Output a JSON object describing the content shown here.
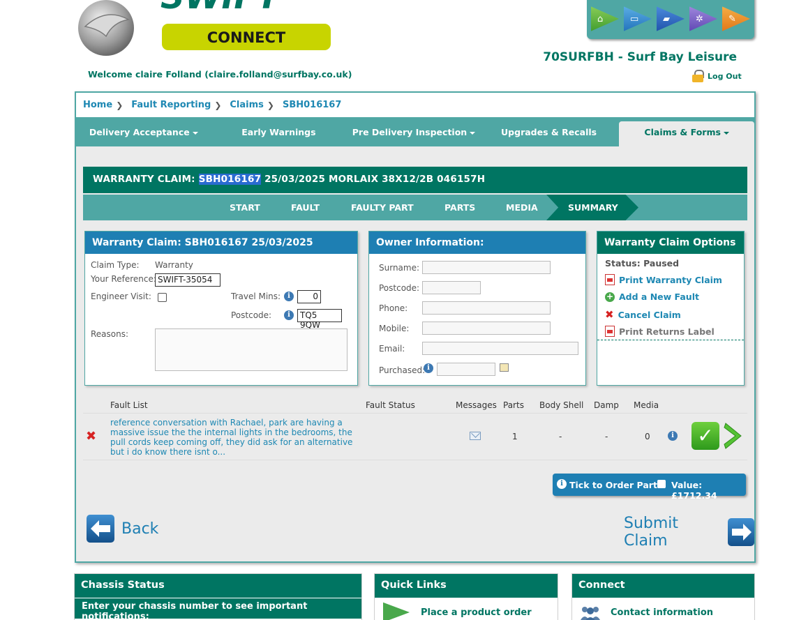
{
  "header": {
    "logo_text": "SWIFT",
    "logo_sub": "CONNECT",
    "welcome": "Welcome claire Folland (claire.folland@surfbay.co.uk)",
    "dealer": "70SURFBH - Surf Bay Leisure",
    "logout": "Log Out",
    "top_icons": [
      "caravan-icon",
      "laptop-icon",
      "truck-icon",
      "gears-icon",
      "tools-icon"
    ]
  },
  "breadcrumb": [
    "Home",
    "Fault Reporting",
    "Claims",
    "SBH016167"
  ],
  "nav": {
    "tabs": [
      "Delivery Acceptance",
      "Early Warnings",
      "Pre Delivery Inspection",
      "Upgrades & Recalls",
      "Claims & Forms"
    ],
    "active": "Claims & Forms"
  },
  "claim_bar": {
    "prefix": "WARRANTY CLAIM:",
    "id": "SBH016167",
    "rest": "25/03/2025 MORLAIX 38X12/2B 046157H"
  },
  "steps": [
    "START",
    "FAULT",
    "FAULTY PART",
    "PARTS",
    "MEDIA",
    "SUMMARY"
  ],
  "claim_panel": {
    "title": "Warranty Claim: SBH016167 25/03/2025",
    "claim_type_label": "Claim Type:",
    "claim_type": "Warranty",
    "your_ref_label": "Your Reference:",
    "your_ref": "SWIFT-35054",
    "engineer_label": "Engineer Visit:",
    "travel_label": "Travel Mins:",
    "travel_value": "0",
    "postcode_label": "Postcode:",
    "postcode_value": "TQ5 9QW",
    "reasons_label": "Reasons:"
  },
  "owner_panel": {
    "title": "Owner Information:",
    "fields": [
      "Surname:",
      "Postcode:",
      "Phone:",
      "Mobile:",
      "Email:",
      "Purchased:"
    ]
  },
  "options_panel": {
    "title": "Warranty Claim Options",
    "status": "Status: Paused",
    "items": [
      "Print Warranty Claim",
      "Add a New Fault",
      "Cancel Claim",
      "Print Returns Label"
    ]
  },
  "fault_list": {
    "headers": [
      "Fault List",
      "Fault Status",
      "Messages",
      "Parts",
      "Body Shell",
      "Damp",
      "Media"
    ],
    "row": {
      "description": "reference conversation with Rachael, park are having a massive issue the the internal lights in the bedrooms, the pull cords keep coming off, they did ask for an alternative but i do know there isnt o...",
      "parts": "1",
      "body_shell": "-",
      "damp": "-",
      "media": "0"
    }
  },
  "order_bar": {
    "label": "Tick to Order Parts:",
    "value": "Value: £1712.34"
  },
  "actions": {
    "back": "Back",
    "submit": "Submit Claim"
  },
  "bottom": {
    "chassis_title": "Chassis Status",
    "chassis_sub": "Enter your chassis number to see important notifications:",
    "quick_title": "Quick Links",
    "quick_item": "Place a product order",
    "connect_title": "Connect",
    "connect_item": "Contact information"
  },
  "colors": {
    "teal": "#007562",
    "light_teal": "#4fa7a4",
    "blue": "#1e7fb3",
    "logo_green": "#c8d400"
  }
}
